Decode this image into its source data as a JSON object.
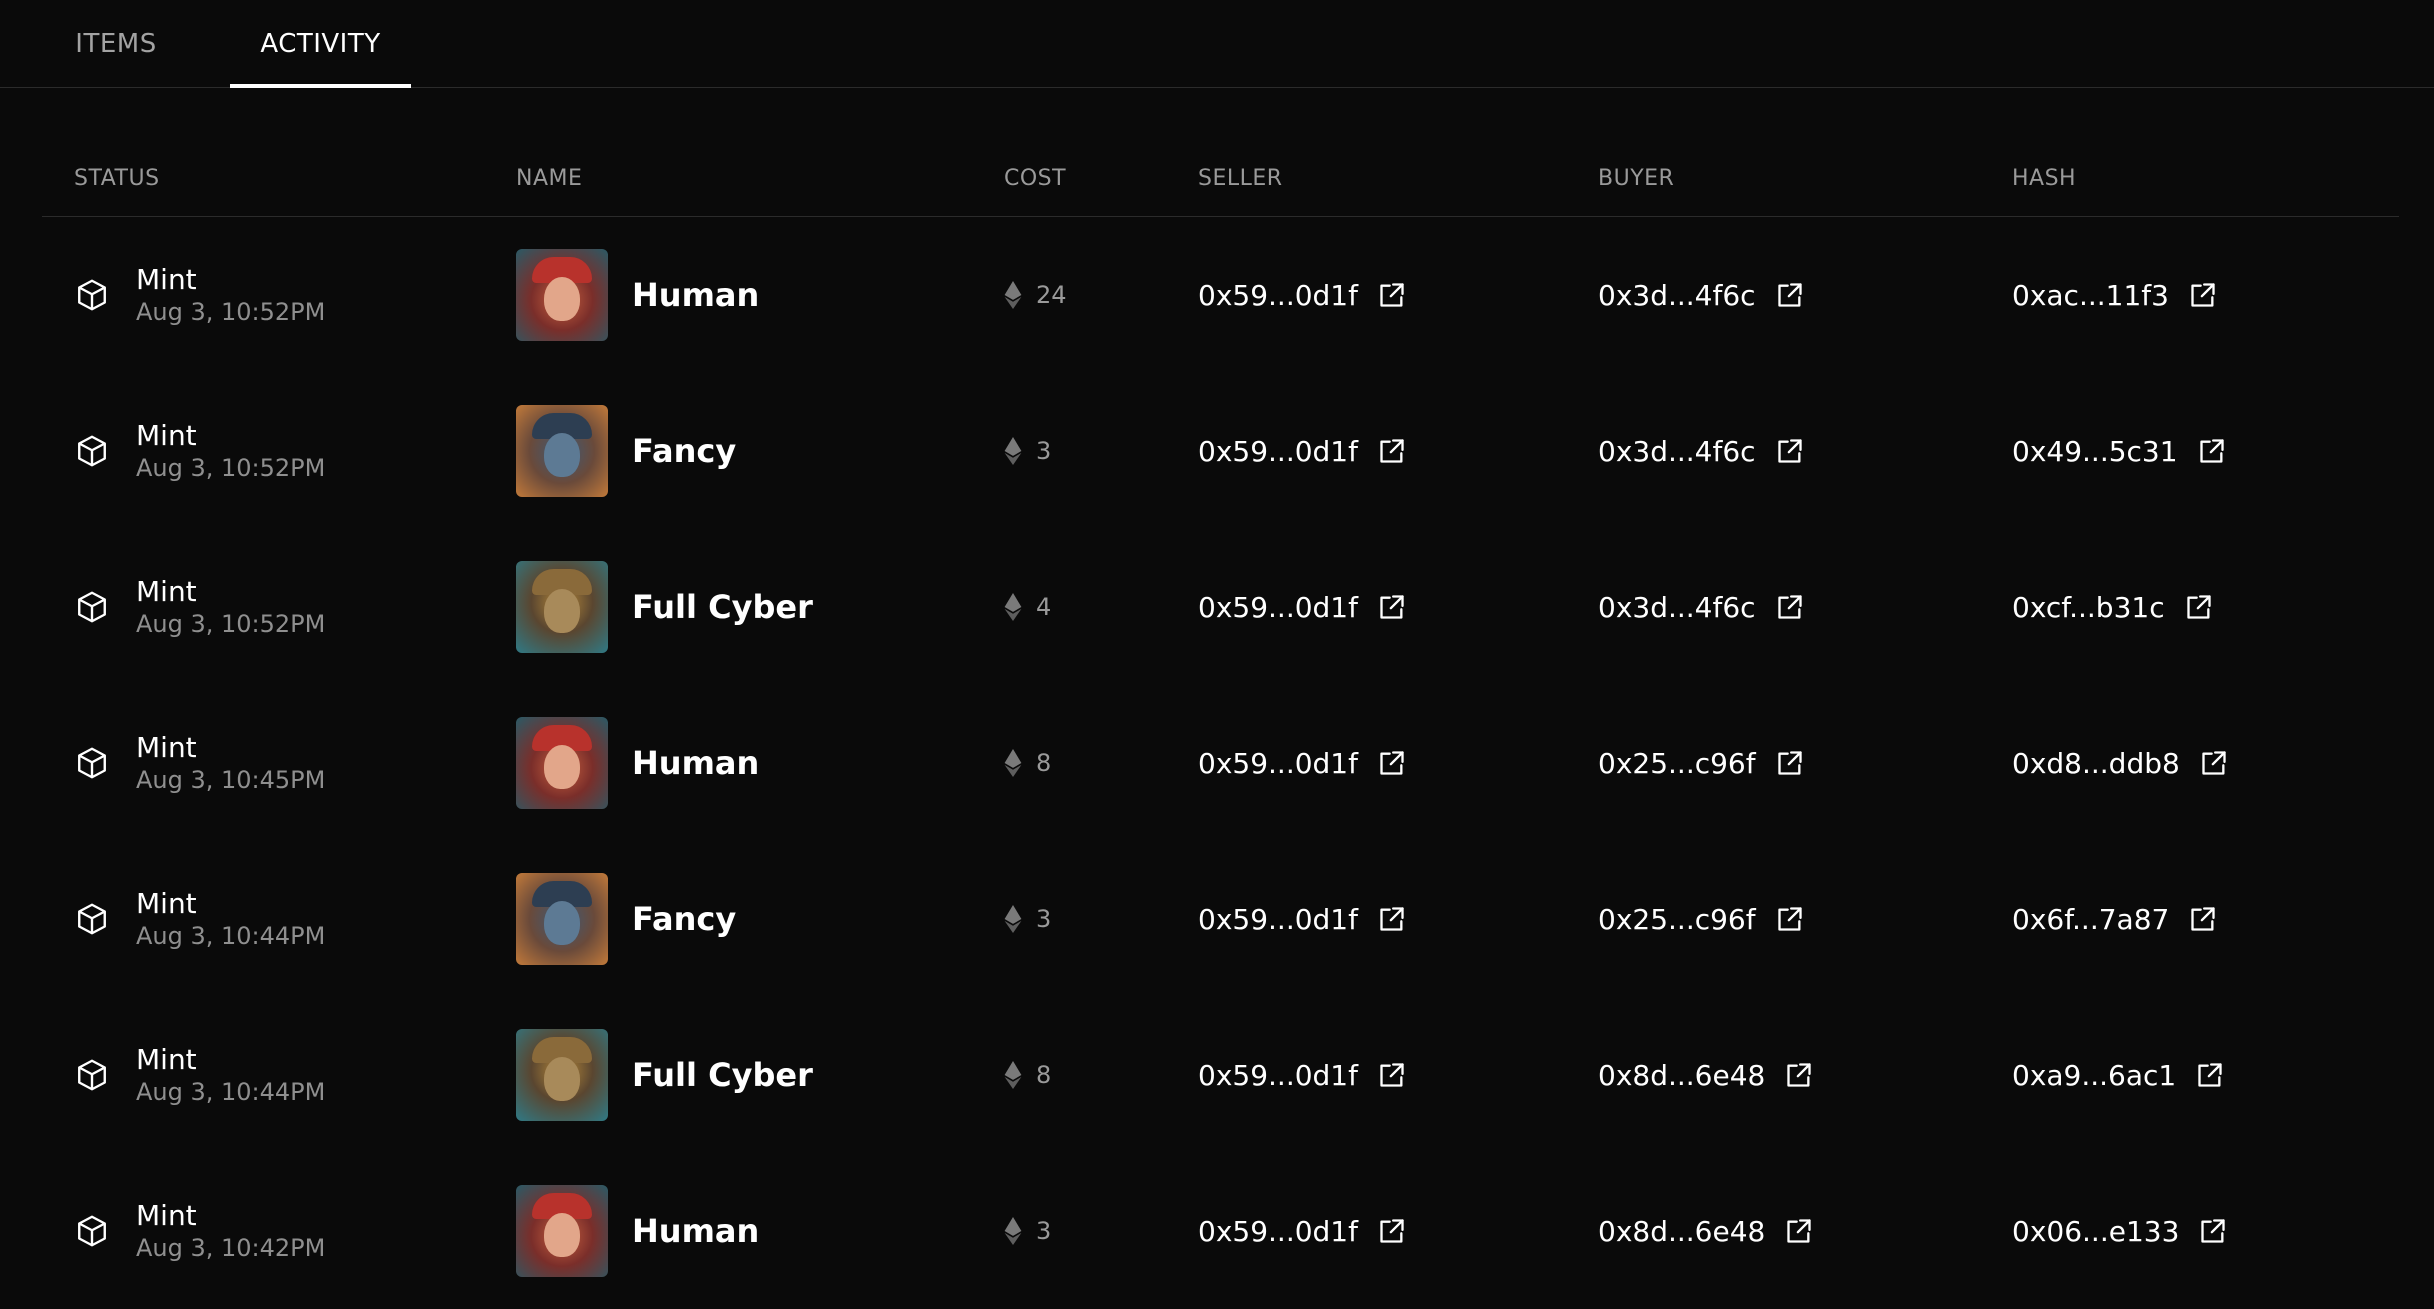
{
  "tabs": [
    {
      "label": "ITEMS",
      "active": false
    },
    {
      "label": "ACTIVITY",
      "active": true
    }
  ],
  "columns": {
    "status": "STATUS",
    "name": "NAME",
    "cost": "COST",
    "seller": "SELLER",
    "buyer": "BUYER",
    "hash": "HASH"
  },
  "icons": {
    "status": "cube-icon",
    "cost": "ethereum-icon",
    "link": "external-link-icon"
  },
  "colors": {
    "background": "#0a0a0a",
    "text": "#ffffff",
    "muted": "#8f8f8f",
    "divider": "#2b2b2b"
  },
  "rows": [
    {
      "status": "Mint",
      "time": "Aug 3, 10:52PM",
      "name": "Human",
      "thumb": "human",
      "cost": "24",
      "seller": "0x59...0d1f",
      "buyer": "0x3d...4f6c",
      "hash": "0xac...11f3"
    },
    {
      "status": "Mint",
      "time": "Aug 3, 10:52PM",
      "name": "Fancy",
      "thumb": "fancy",
      "cost": "3",
      "seller": "0x59...0d1f",
      "buyer": "0x3d...4f6c",
      "hash": "0x49...5c31"
    },
    {
      "status": "Mint",
      "time": "Aug 3, 10:52PM",
      "name": "Full Cyber",
      "thumb": "cyber",
      "cost": "4",
      "seller": "0x59...0d1f",
      "buyer": "0x3d...4f6c",
      "hash": "0xcf...b31c"
    },
    {
      "status": "Mint",
      "time": "Aug 3, 10:45PM",
      "name": "Human",
      "thumb": "human",
      "cost": "8",
      "seller": "0x59...0d1f",
      "buyer": "0x25...c96f",
      "hash": "0xd8...ddb8"
    },
    {
      "status": "Mint",
      "time": "Aug 3, 10:44PM",
      "name": "Fancy",
      "thumb": "fancy",
      "cost": "3",
      "seller": "0x59...0d1f",
      "buyer": "0x25...c96f",
      "hash": "0x6f...7a87"
    },
    {
      "status": "Mint",
      "time": "Aug 3, 10:44PM",
      "name": "Full Cyber",
      "thumb": "cyber",
      "cost": "8",
      "seller": "0x59...0d1f",
      "buyer": "0x8d...6e48",
      "hash": "0xa9...6ac1"
    },
    {
      "status": "Mint",
      "time": "Aug 3, 10:42PM",
      "name": "Human",
      "thumb": "human",
      "cost": "3",
      "seller": "0x59...0d1f",
      "buyer": "0x8d...6e48",
      "hash": "0x06...e133"
    }
  ]
}
